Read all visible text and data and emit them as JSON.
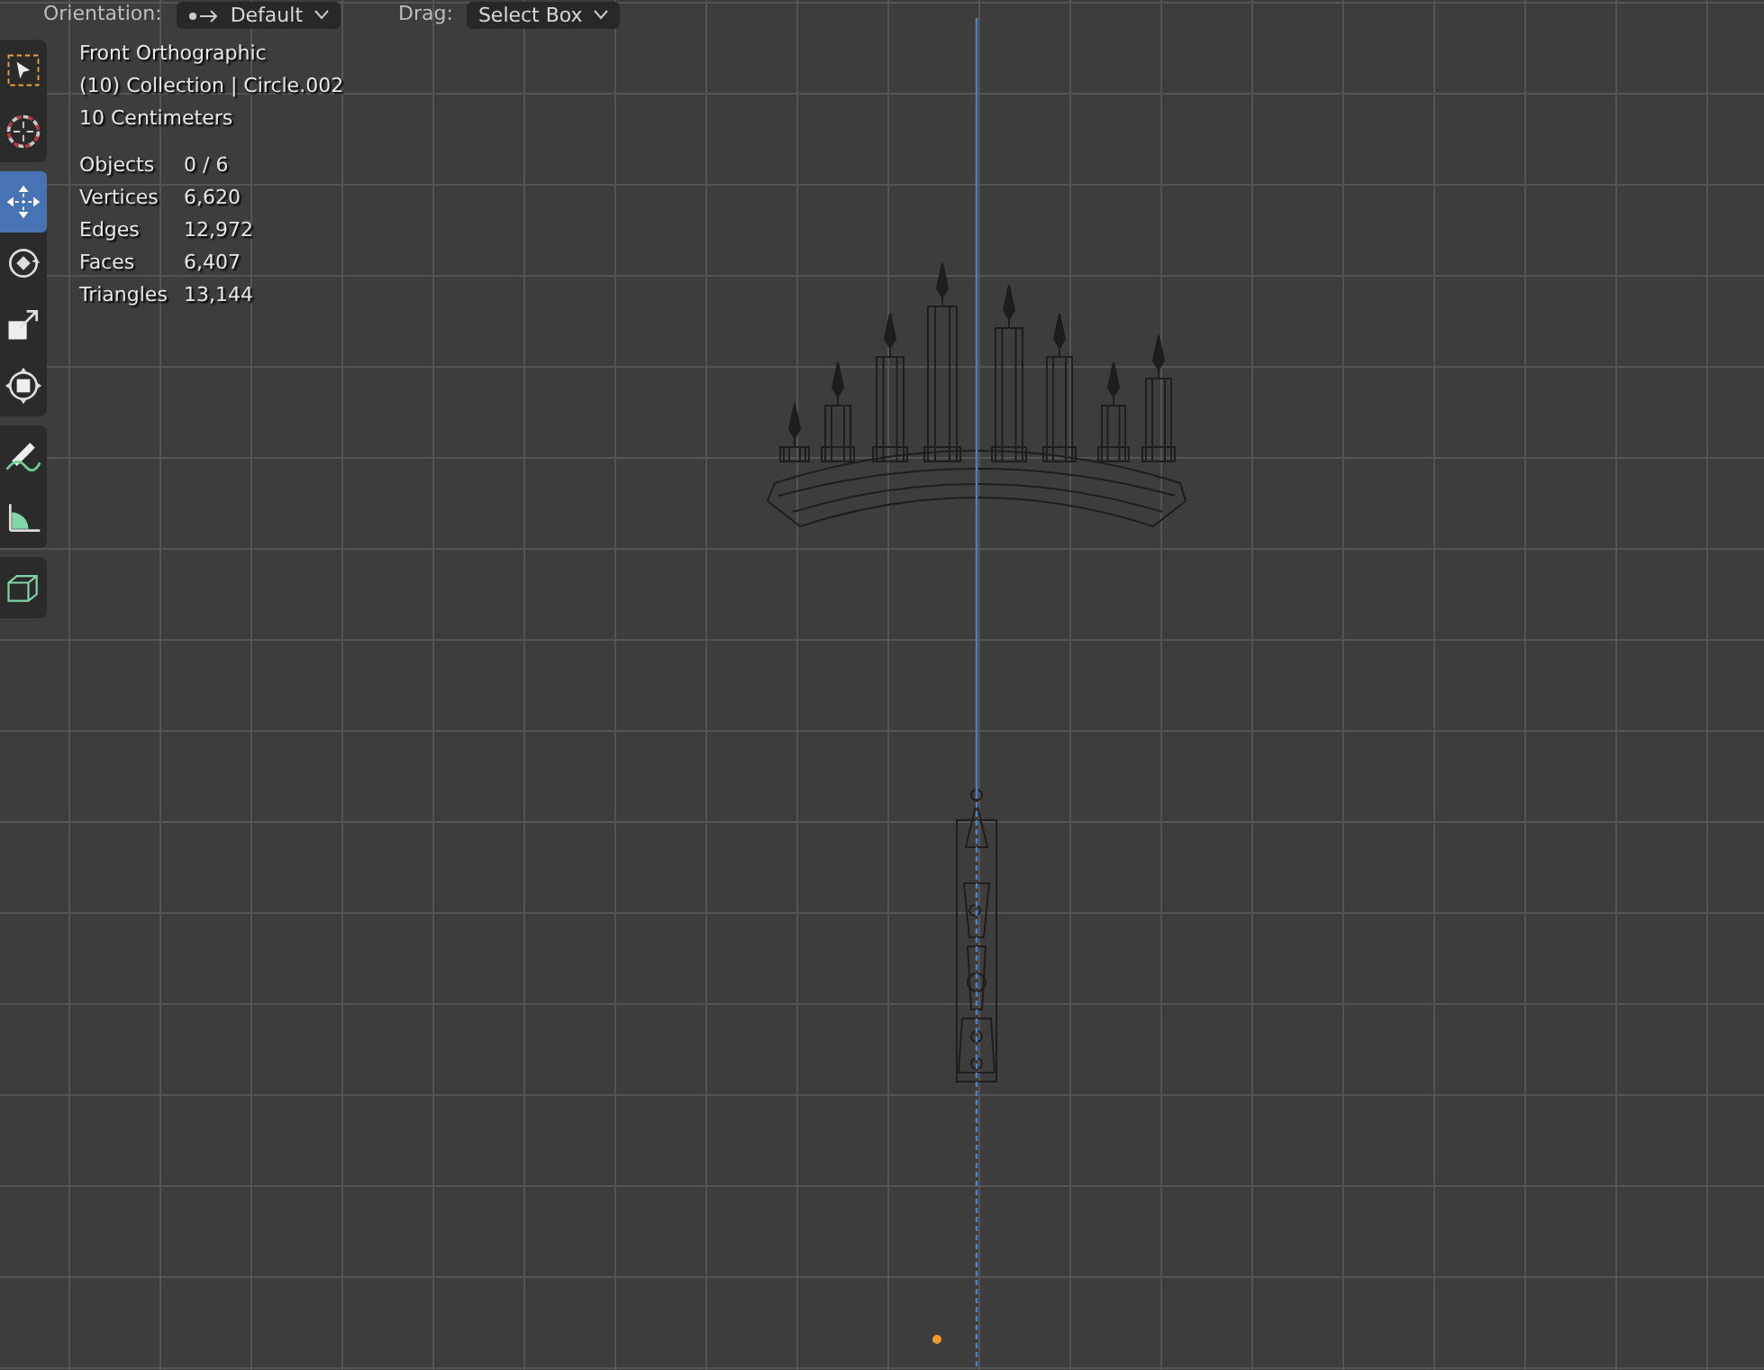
{
  "header": {
    "orientation_label": "Orientation:",
    "orientation_value": "Default",
    "drag_label": "Drag:",
    "drag_value": "Select Box"
  },
  "toolbar": [
    {
      "kind": "select",
      "selected": false
    },
    {
      "kind": "cursor",
      "selected": false
    },
    {
      "kind": "move",
      "selected": true
    },
    {
      "kind": "rotate",
      "selected": false
    },
    {
      "kind": "scale",
      "selected": false
    },
    {
      "kind": "transform",
      "selected": false
    },
    {
      "kind": "annotate",
      "selected": false
    },
    {
      "kind": "measure",
      "selected": false
    },
    {
      "kind": "add",
      "selected": false
    }
  ],
  "overlay": {
    "view_name": "Front Orthographic",
    "collection": "(10) Collection | Circle.002",
    "scale": "10 Centimeters",
    "stats": [
      {
        "label": "Objects",
        "value": "0 / 6"
      },
      {
        "label": "Vertices",
        "value": "6,620"
      },
      {
        "label": "Edges",
        "value": "12,972"
      },
      {
        "label": "Faces",
        "value": "6,407"
      },
      {
        "label": "Triangles",
        "value": "13,144"
      }
    ]
  }
}
